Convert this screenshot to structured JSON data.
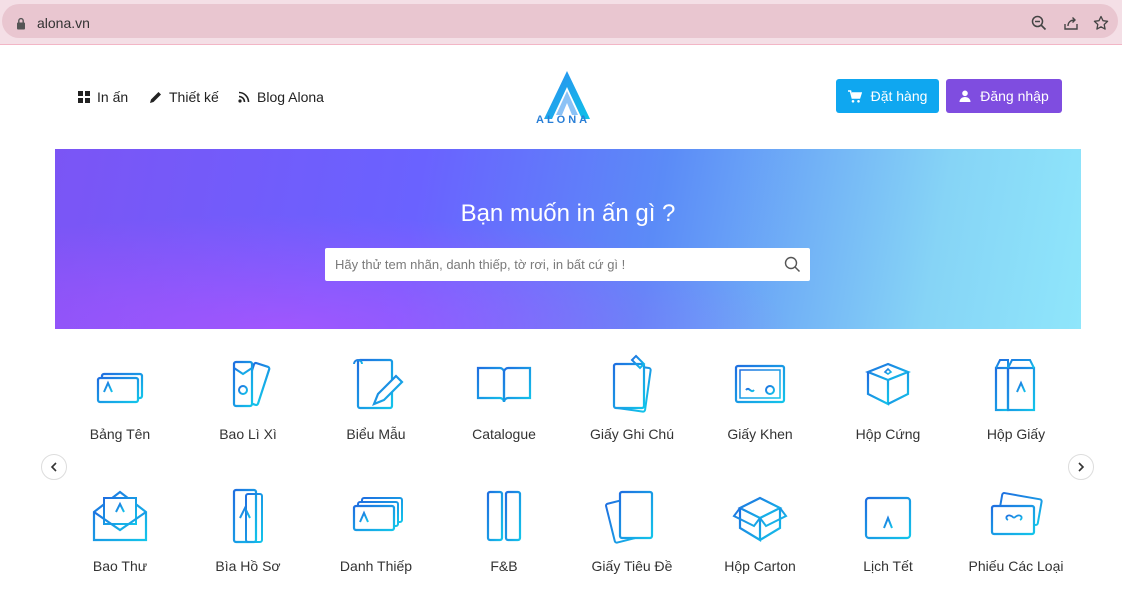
{
  "browser": {
    "url": "alona.vn"
  },
  "nav": {
    "items": [
      {
        "label": "In ấn",
        "icon": "grid-icon"
      },
      {
        "label": "Thiết kế",
        "icon": "pencil-icon"
      },
      {
        "label": "Blog Alona",
        "icon": "rss-icon"
      }
    ]
  },
  "logo": {
    "text": "ALONA"
  },
  "actions": {
    "order_label": "Đặt hàng",
    "login_label": "Đăng nhập"
  },
  "hero": {
    "title": "Bạn muốn in ấn gì ?",
    "search_placeholder": "Hãy thử tem nhãn, danh thiếp, tờ rơi, in bất cứ gì !"
  },
  "categories": {
    "row1": [
      {
        "label": "Bảng Tên",
        "icon": "name-card-icon"
      },
      {
        "label": "Bao Lì Xì",
        "icon": "red-envelope-icon"
      },
      {
        "label": "Biểu Mẫu",
        "icon": "form-pen-icon"
      },
      {
        "label": "Catalogue",
        "icon": "open-book-icon"
      },
      {
        "label": "Giấy Ghi Chú",
        "icon": "note-paper-icon"
      },
      {
        "label": "Giấy Khen",
        "icon": "certificate-icon"
      },
      {
        "label": "Hộp Cứng",
        "icon": "hard-box-icon"
      },
      {
        "label": "Hộp Giấy",
        "icon": "paper-box-icon"
      }
    ],
    "row2": [
      {
        "label": "Bao Thư",
        "icon": "envelope-icon"
      },
      {
        "label": "Bìa Hồ Sơ",
        "icon": "folder-icon"
      },
      {
        "label": "Danh Thiếp",
        "icon": "business-card-icon"
      },
      {
        "label": "F&B",
        "icon": "fnb-pack-icon"
      },
      {
        "label": "Giấy Tiêu Đề",
        "icon": "letterhead-icon"
      },
      {
        "label": "Hộp Carton",
        "icon": "carton-icon"
      },
      {
        "label": "Lịch Tết",
        "icon": "calendar-icon"
      },
      {
        "label": "Phiếu Các Loại",
        "icon": "voucher-icon"
      }
    ]
  },
  "colors": {
    "accent_blue": "#0fa7f0",
    "accent_purple": "#7f4de0",
    "icon_stroke": "#1e8fe0"
  }
}
